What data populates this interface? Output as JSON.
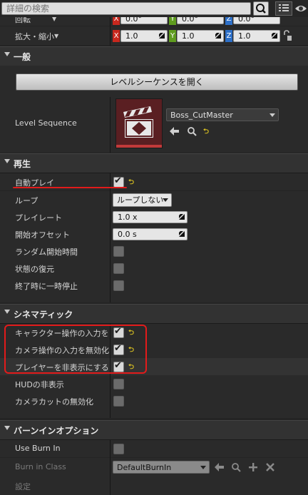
{
  "search": {
    "placeholder": "詳細の検索"
  },
  "transform": {
    "rotation_label": "回転",
    "scale_label": "拡大・縮小",
    "rotation": {
      "x": "0.0°",
      "y": "0.0°",
      "z": "0.0°"
    },
    "scale": {
      "x": "1.0",
      "y": "1.0",
      "z": "1.0"
    },
    "axis_x": "X",
    "axis_y": "Y",
    "axis_z": "Z"
  },
  "general": {
    "title": "一般",
    "open_button": "レベルシーケンスを開く",
    "level_sequence_label": "Level Sequence",
    "asset_name": "Boss_CutMaster"
  },
  "playback": {
    "title": "再生",
    "autoplay_label": "自動プレイ",
    "loop_label": "ループ",
    "loop_value": "ループしない",
    "playrate_label": "プレイレート",
    "playrate_value": "1.0 x",
    "start_offset_label": "開始オフセット",
    "start_offset_value": "0.0 s",
    "random_start_label": "ランダム開始時間",
    "restore_state_label": "状態の復元",
    "pause_at_end_label": "終了時に一時停止"
  },
  "cinematic": {
    "title": "シネマティック",
    "disable_movement_label": "キャラクター操作の入力を無",
    "disable_look_label": "カメラ操作の入力を無効化",
    "hide_player_label": "プレイヤーを非表示にする",
    "hide_hud_label": "HUDの非表示",
    "disable_camera_cuts_label": "カメラカットの無効化"
  },
  "burnin": {
    "title": "バーンインオプション",
    "use_burnin_label": "Use Burn In",
    "burnin_class_label": "Burn in Class",
    "burnin_class_value": "DefaultBurnIn",
    "settings_label": "設定"
  },
  "colors": {
    "axis_x": "#c8281e",
    "axis_y": "#5f9c1f",
    "axis_z": "#2d6fc7",
    "annotation_red": "#e21b1b",
    "reset_yellow": "#d9c021"
  }
}
